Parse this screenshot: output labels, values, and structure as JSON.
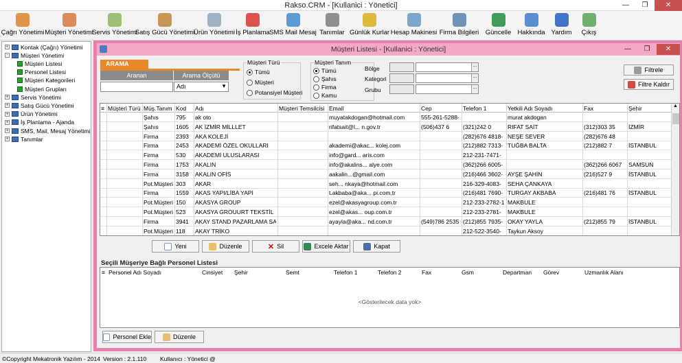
{
  "window": {
    "title": "Rakso.CRM  -  [Kullanici : Yönetici]"
  },
  "toolbar": [
    {
      "label": "Çağrı Yönetimi",
      "icon": "person-headset-icon",
      "color": "#e0954a"
    },
    {
      "label": "Müşteri Yönetimi",
      "icon": "people-icon",
      "color": "#d98c5a"
    },
    {
      "label": "Servis Yönetimi",
      "icon": "tools-icon",
      "color": "#9bbf73"
    },
    {
      "label": "Satış Gücü Yönetimi",
      "icon": "briefcase-icon",
      "color": "#c99655"
    },
    {
      "label": "Ürün Yönetimi",
      "icon": "document-icon",
      "color": "#9fb2c6"
    },
    {
      "label": "İş Planlama",
      "icon": "calendar-icon",
      "color": "#d9534f"
    },
    {
      "label": "SMS Mail Mesaj",
      "icon": "mail-icon",
      "color": "#5b9bd5"
    },
    {
      "label": "Tanımlar",
      "icon": "list-icon",
      "color": "#8e8e8e"
    },
    {
      "label": "Günlük Kurlar",
      "icon": "coin-icon",
      "color": "#e0b83a"
    },
    {
      "label": "Hesap Makinesi",
      "icon": "calculator-icon",
      "color": "#7aa6c9"
    },
    {
      "label": "Firma Bilgileri",
      "icon": "building-icon",
      "color": "#6f93b8"
    },
    {
      "label": "Güncelle",
      "icon": "globe-icon",
      "color": "#3f9d57"
    },
    {
      "label": "Hakkında",
      "icon": "info-icon",
      "color": "#5a8ed0"
    },
    {
      "label": "Yardım",
      "icon": "help-icon",
      "color": "#3f74c6"
    },
    {
      "label": "Çıkış",
      "icon": "exit-icon",
      "color": "#6fb06f"
    }
  ],
  "nav": [
    {
      "label": "Kontak (Çağrı) Yönetimi",
      "level": 0,
      "exp": "+"
    },
    {
      "label": "Müşteri Yönetimi",
      "level": 0,
      "exp": "-"
    },
    {
      "label": "Müşteri Listesi",
      "level": 1,
      "exp": ""
    },
    {
      "label": "Personel Listesi",
      "level": 1,
      "exp": ""
    },
    {
      "label": "Müşteri Kategorileri",
      "level": 1,
      "exp": ""
    },
    {
      "label": "Müşteri Grupları",
      "level": 1,
      "exp": ""
    },
    {
      "label": "Servis Yönetimi",
      "level": 0,
      "exp": "+"
    },
    {
      "label": "Satış Gücü Yönetimi",
      "level": 0,
      "exp": "+"
    },
    {
      "label": "Ürün Yönetimi",
      "level": 0,
      "exp": "+"
    },
    {
      "label": "İş Planlama - Ajanda",
      "level": 0,
      "exp": "+"
    },
    {
      "label": "SMS, Mail, Mesaj Yönetimi",
      "level": 0,
      "exp": "+"
    },
    {
      "label": "Tanımlar",
      "level": 0,
      "exp": "+"
    }
  ],
  "child": {
    "title": "Müşteri Listesi  -  [Kullanici : Yönetici]"
  },
  "search": {
    "tab": "ARAMA",
    "col_aranan": "Aranan",
    "col_olcut": "Arama Ölçütü",
    "aranan_value": "",
    "olcut_value": "Adı"
  },
  "musteri_turu": {
    "title": "Müşteri Türü",
    "options": [
      "Tümü",
      "Müşteri",
      "Potansiyel Müşteri"
    ],
    "selected": 0
  },
  "musteri_tanim": {
    "title": "Müşteri Tanım",
    "options": [
      "Tümü",
      "Şahıs",
      "Firma",
      "Kamu"
    ],
    "selected": 0
  },
  "filters": {
    "bolge": "Bölge",
    "kategori": "Kategori",
    "grubu": "Grubu"
  },
  "buttons": {
    "filtrele": "Filtrele",
    "filtre_kaldir": "Filtre Kaldır",
    "yeni": "Yeni",
    "duzenle": "Düzenle",
    "sil": "Sil",
    "excele": "Excele Aktar",
    "kapat": "Kapat",
    "personel_ekle": "Personel Ekle",
    "duzenle2": "Düzenle"
  },
  "grid": {
    "columns": [
      "Müşteri Türü",
      "Müş.Tanım",
      "Kod",
      "Adı",
      "Müşteri Temsilcisi",
      "Email",
      "Cep",
      "Telefon 1",
      "Yetkili Adı Soyadı",
      "Fax",
      "Şehir"
    ],
    "rows": [
      [
        "",
        "Şahıs",
        "795",
        "ak oto",
        "",
        "muyatakdogan@hotmail.com",
        "555-261-5288-",
        "",
        "murat akdogan",
        "",
        ""
      ],
      [
        "",
        "Şahıs",
        "1605",
        "AK İZMİR MİLLLET",
        "",
        "rifatsait@l... n.gov.tr",
        "(506)437 6",
        "(321)242 0",
        "RIFAT SAİT",
        "(312)303 35",
        "İZMİR"
      ],
      [
        "",
        "Firma",
        "2393",
        "AKA KOLEJİ",
        "",
        "",
        "",
        "(282)676 4818-",
        "NEŞE SEVER",
        "(282)676 48",
        ""
      ],
      [
        "",
        "Firma",
        "2453",
        "AKADEMİ ÖZEL OKULLARI",
        "",
        "akademi@akac... kolej.com",
        "",
        "(212)882 7313-",
        "TUĞBA BALTA",
        "(212)882 7",
        "İSTANBUL"
      ],
      [
        "",
        "Firma",
        "530",
        "AKADEMİ ULUSLARASI",
        "",
        "info@gard... aris.com",
        "",
        "212-231-7471-",
        "",
        "",
        ""
      ],
      [
        "",
        "Firma",
        "1753",
        "AKALIN",
        "",
        "info@akalins... alye.com",
        "",
        "(362)266 6005-",
        "",
        "(362)266 6067",
        "SAMSUN"
      ],
      [
        "",
        "Firma",
        "3158",
        "AKALIN OFİS",
        "",
        "aakalin...@gmail.com",
        "",
        "(216)466 3602-",
        "AYŞE ŞAHİN",
        "(216)527 9",
        "İSTANBUL"
      ],
      [
        "",
        "Pot.Müşteri",
        "303",
        "AKAR",
        "",
        "seh... nkaya@hotmail.com",
        "",
        "216-329-4083-",
        "SEHA ÇANKAYA",
        "",
        ""
      ],
      [
        "",
        "Firma",
        "1559",
        "AKAS YAPI/LİBA YAPI",
        "",
        "t.akbaba@aka... pi.com.tr",
        "",
        "(216)481 7690-",
        "TURGAY AKBABA",
        "(216)481 76",
        "İSTANBUL"
      ],
      [
        "",
        "Pot.Müşteri",
        "150",
        "AKASYA GROUP",
        "",
        "ezel@akasyagroup.com.tr",
        "",
        "212-233-2782-1",
        "MAKBULE",
        "",
        ""
      ],
      [
        "",
        "Pot.Müşteri",
        "523",
        "AKASYA GROUURT TEKSTİL",
        "",
        "ezel@akas... oup.com.tr",
        "",
        "212-233-2781-",
        "MAKBULE",
        "",
        ""
      ],
      [
        "",
        "Firma",
        "3941",
        "AKAY STAND PAZARLAMA SAN.",
        "",
        "ayayla@aka... nd.com.tr",
        "(549)786 2535",
        "(212)855 7935-",
        "OKAY YAYLA",
        "(212)855 79",
        "İSTANBUL"
      ],
      [
        "",
        "Pot.Müşteri",
        "118",
        "AKAY TRİKO",
        "",
        "",
        "",
        "212-522-3540-",
        "Taykun Aksoy",
        "",
        ""
      ]
    ]
  },
  "personel": {
    "title": "Seçili Müşeriye Bağlı Personel Listesi",
    "columns": [
      "Personel Adı Soyadı",
      "Cinsiyet",
      "Şehir",
      "Semt",
      "Telefon 1",
      "Telefon 2",
      "Fax",
      "Gsm",
      "Departman",
      "Görev",
      "Uzmanlık Alanı"
    ],
    "empty": "<Gösterilecek data yok>"
  },
  "status": {
    "copyright": "©Copyright Mekatronik Yazılım - 2014",
    "version": "Version : 2.1.110",
    "user": "Kullanıcı : Yönetici @"
  }
}
